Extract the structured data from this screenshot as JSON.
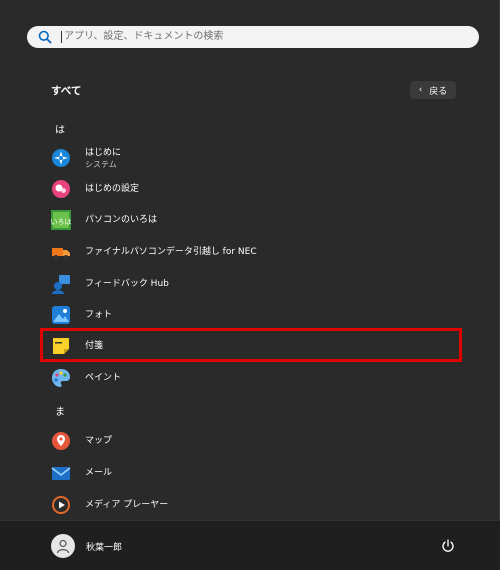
{
  "search": {
    "placeholder": "アプリ、設定、ドキュメントの検索",
    "icon": "search-icon"
  },
  "header": {
    "title": "すべて",
    "back_label": "戻る",
    "back_icon": "chevron-left-icon"
  },
  "sections": [
    {
      "letter": "は",
      "apps": [
        {
          "name": "はじめに",
          "subtitle": "システム",
          "icon": "get-started-icon"
        },
        {
          "name": "はじめの設定",
          "icon": "initial-setup-icon"
        },
        {
          "name": "パソコンのいろは",
          "icon": "iroha-icon"
        },
        {
          "name": "ファイナルパソコンデータ引越し for NEC",
          "icon": "moving-truck-icon"
        },
        {
          "name": "フィードバック Hub",
          "icon": "feedback-hub-icon"
        },
        {
          "name": "フォト",
          "icon": "photos-icon"
        },
        {
          "name": "付箋",
          "icon": "sticky-notes-icon"
        },
        {
          "name": "ペイント",
          "icon": "paint-palette-icon"
        }
      ]
    },
    {
      "letter": "ま",
      "apps": [
        {
          "name": "マップ",
          "icon": "maps-pin-icon"
        },
        {
          "name": "メール",
          "icon": "mail-envelope-icon"
        },
        {
          "name": "メディア プレーヤー",
          "icon": "media-player-icon"
        }
      ]
    }
  ],
  "footer": {
    "user_name": "秋葉一郎",
    "avatar_icon": "user-avatar-icon",
    "power_icon": "power-icon"
  },
  "colors": {
    "highlight": "#e00000",
    "background": "#2a2a2a",
    "accent": "#0078d4"
  }
}
